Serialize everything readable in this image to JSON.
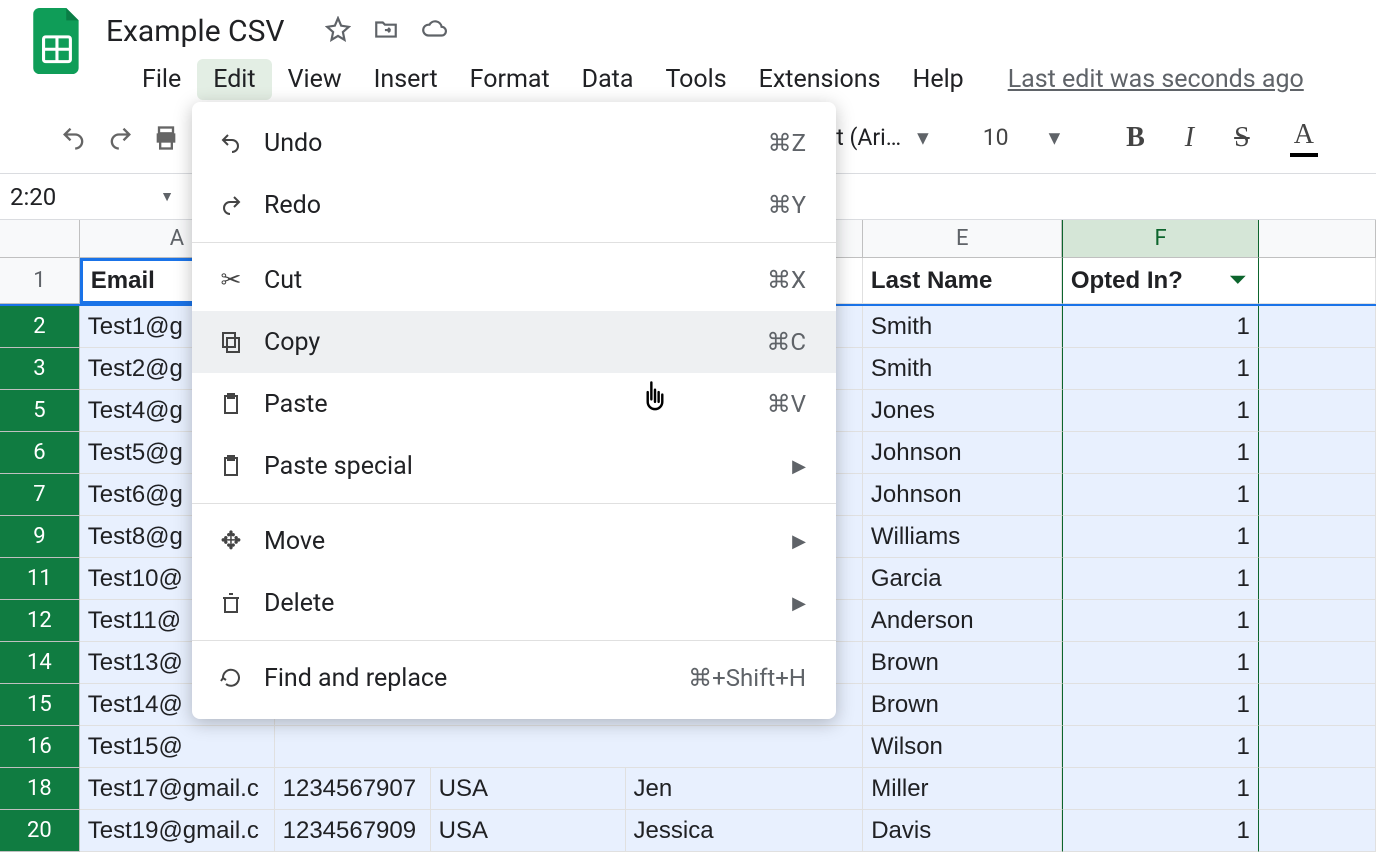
{
  "doc_title": "Example CSV",
  "menubar": {
    "file": "File",
    "edit": "Edit",
    "view": "View",
    "insert": "Insert",
    "format": "Format",
    "data": "Data",
    "tools": "Tools",
    "extensions": "Extensions",
    "help": "Help",
    "last_edit": "Last edit was seconds ago"
  },
  "toolbar": {
    "font_name": "ult (Ari…",
    "font_size": "10"
  },
  "namebox": "2:20",
  "columns": [
    "A",
    "E",
    "F"
  ],
  "header_row": {
    "A": "Email",
    "E": "Last Name",
    "F": "Opted In?"
  },
  "visible_row_numbers": [
    "1",
    "2",
    "3",
    "5",
    "6",
    "7",
    "9",
    "11",
    "12",
    "14",
    "15",
    "16",
    "18",
    "20"
  ],
  "rows": [
    {
      "n": "2",
      "A": "Test1@g",
      "E": "Smith",
      "F": "1"
    },
    {
      "n": "3",
      "A": "Test2@g",
      "E": "Smith",
      "F": "1"
    },
    {
      "n": "5",
      "A": "Test4@g",
      "E": "Jones",
      "F": "1"
    },
    {
      "n": "6",
      "A": "Test5@g",
      "E": "Johnson",
      "F": "1"
    },
    {
      "n": "7",
      "A": "Test6@g",
      "E": "Johnson",
      "F": "1"
    },
    {
      "n": "9",
      "A": "Test8@g",
      "E": "Williams",
      "F": "1"
    },
    {
      "n": "11",
      "A": "Test10@",
      "E": "Garcia",
      "F": "1"
    },
    {
      "n": "12",
      "A": "Test11@",
      "E": "Anderson",
      "F": "1"
    },
    {
      "n": "14",
      "A": "Test13@",
      "E": "Brown",
      "F": "1"
    },
    {
      "n": "15",
      "A": "Test14@",
      "E": "Brown",
      "F": "1"
    },
    {
      "n": "16",
      "A": "Test15@",
      "E": "Wilson",
      "F": "1"
    },
    {
      "n": "18",
      "A": "Test17@gmail.c",
      "B": "1234567907",
      "C": "USA",
      "D": "Jen",
      "E": "Miller",
      "F": "1"
    },
    {
      "n": "20",
      "A": "Test19@gmail.c",
      "B": "1234567909",
      "C": "USA",
      "D": "Jessica",
      "E": "Davis",
      "F": "1"
    }
  ],
  "edit_menu": {
    "undo": {
      "label": "Undo",
      "shortcut": "⌘Z"
    },
    "redo": {
      "label": "Redo",
      "shortcut": "⌘Y"
    },
    "cut": {
      "label": "Cut",
      "shortcut": "⌘X"
    },
    "copy": {
      "label": "Copy",
      "shortcut": "⌘C"
    },
    "paste": {
      "label": "Paste",
      "shortcut": "⌘V"
    },
    "paste_special": {
      "label": "Paste special"
    },
    "move": {
      "label": "Move"
    },
    "delete": {
      "label": "Delete"
    },
    "find": {
      "label": "Find and replace",
      "shortcut": "⌘+Shift+H"
    }
  }
}
